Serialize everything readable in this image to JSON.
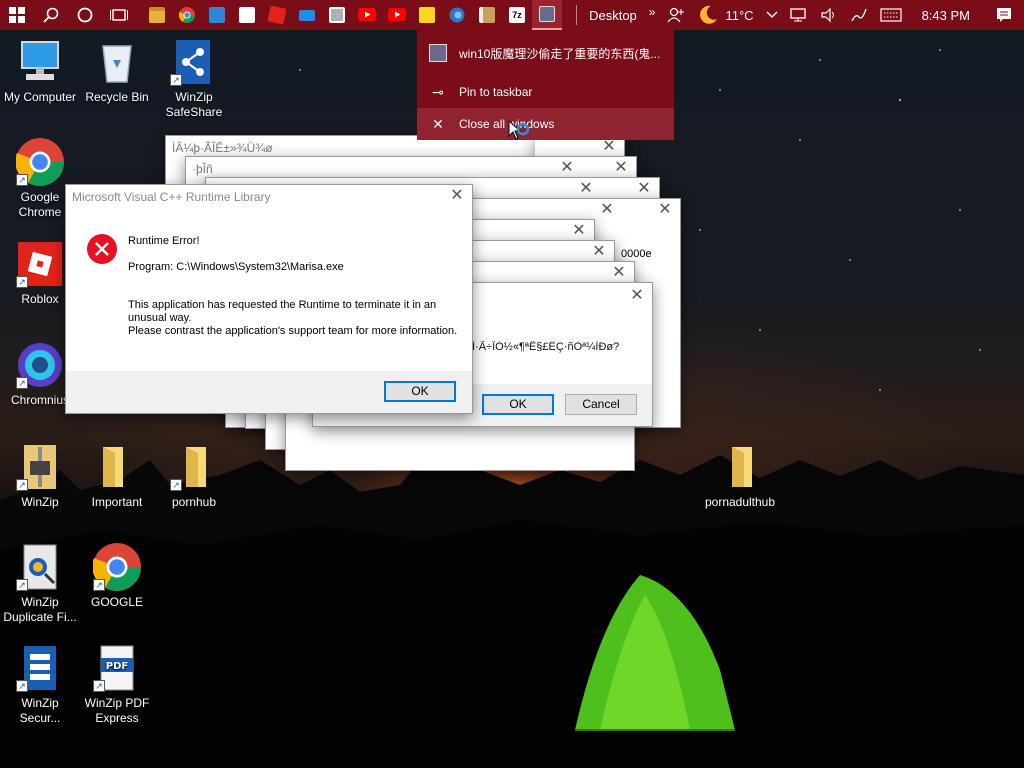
{
  "taskbar": {
    "start_icon": "windows-logo-icon",
    "search_icon": "search-icon",
    "cortana_icon": "circle-icon",
    "taskview_icon": "task-view-icon",
    "apps": [
      {
        "name": "file-explorer",
        "color": "#e8b13a"
      },
      {
        "name": "chrome",
        "color": "#4285f4"
      },
      {
        "name": "photos",
        "color": "#2b88d8"
      },
      {
        "name": "windows",
        "color": "#ffffff"
      },
      {
        "name": "roblox",
        "color": "#e2231a"
      },
      {
        "name": "mail",
        "color": "#1f8ceb"
      },
      {
        "name": "image",
        "color": "#b0b0b0"
      },
      {
        "name": "youtube",
        "color": "#ff0000"
      },
      {
        "name": "youtube-2",
        "color": "#ff0000"
      },
      {
        "name": "sticky-notes",
        "color": "#f9d71c"
      },
      {
        "name": "edge",
        "color": "#3277bc"
      },
      {
        "name": "winzip",
        "color": "#c8a25b"
      },
      {
        "name": "7zip",
        "color": "#ffffff"
      },
      {
        "name": "touhou",
        "color": "#6a6a8a"
      }
    ],
    "desktop_label": "Desktop",
    "chevron": "»",
    "weather_temp": "11°C",
    "time": "8:43 PM"
  },
  "jumplist": {
    "app_title": "win10版魔理沙偷走了重要的东西(鬼...",
    "pin_label": "Pin to taskbar",
    "close_label": "Close all windows"
  },
  "desktop_icons": [
    {
      "label": "My Computer"
    },
    {
      "label": "Recycle Bin"
    },
    {
      "label": "WinZip SafeShare"
    },
    {
      "label": "Google Chrome"
    },
    {
      "label": "Roblox"
    },
    {
      "label": "Chromnius"
    },
    {
      "label": "WinZip"
    },
    {
      "label": "Important"
    },
    {
      "label": "pornhub"
    },
    {
      "label": "pornadulthub"
    },
    {
      "label": "WinZip Duplicate Fi..."
    },
    {
      "label": "GOOGLE"
    },
    {
      "label": "WinZip Secur..."
    },
    {
      "label": "WinZip PDF Express"
    }
  ],
  "background_windows": {
    "title_1": "ÌÂ¼þ·ÃÎÊ±»¾Ü¾ø",
    "title_2": "·þÎñ",
    "code_text": "0000e",
    "message": "ÊÇ·ñÒªÈÃ·ÀÍÏÎÄ·ÅÎÍÌ·Ã÷ÎÒ½«¶ªÊ§£ËÇ·ñÒª¼ÌÐø?",
    "ok_label": "OK",
    "cancel_label": "Cancel"
  },
  "error_dialog": {
    "title": "Microsoft Visual C++ Runtime Library",
    "heading": "Runtime Error!",
    "program": "Program: C:\\Windows\\System32\\Marisa.exe",
    "message_1": "This application has requested the Runtime to terminate it in an unusual way.",
    "message_2": "Please contrast the application's support team for more information.",
    "ok_label": "OK"
  }
}
